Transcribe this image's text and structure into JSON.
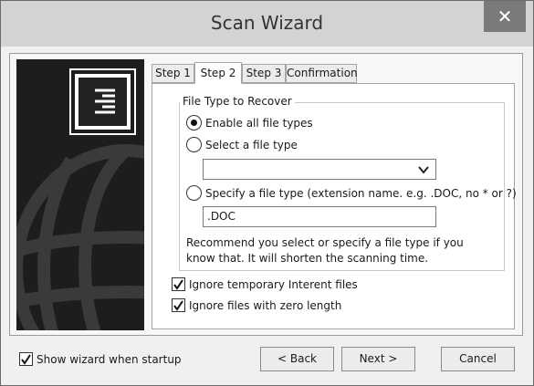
{
  "window": {
    "title": "Scan Wizard",
    "close_symbol": "✕"
  },
  "tabs": [
    {
      "label": "Step 1",
      "active": false
    },
    {
      "label": "Step 2",
      "active": true
    },
    {
      "label": "Step 3",
      "active": false
    },
    {
      "label": "Confirmation",
      "active": false
    }
  ],
  "file_type": {
    "group_label": "File Type to Recover",
    "options": [
      {
        "label": "Enable all file types",
        "selected": true
      },
      {
        "label": "Select a file type",
        "selected": false
      },
      {
        "label": "Specify a file type (extension name. e.g. .DOC, no * or ?)",
        "selected": false
      }
    ],
    "select_value": "",
    "extension_value": ".DOC",
    "note": "Recommend you select or specify a file type if you know that. It will shorten the scanning time."
  },
  "checkboxes": {
    "ignore_temp": {
      "label": "Ignore temporary Interent files",
      "checked": true
    },
    "ignore_zero": {
      "label": "Ignore files with zero length",
      "checked": true
    }
  },
  "footer": {
    "show_wizard": {
      "label": "Show wizard when startup",
      "checked": true
    },
    "back_label": "< Back",
    "next_label": "Next >",
    "cancel_label": "Cancel"
  }
}
